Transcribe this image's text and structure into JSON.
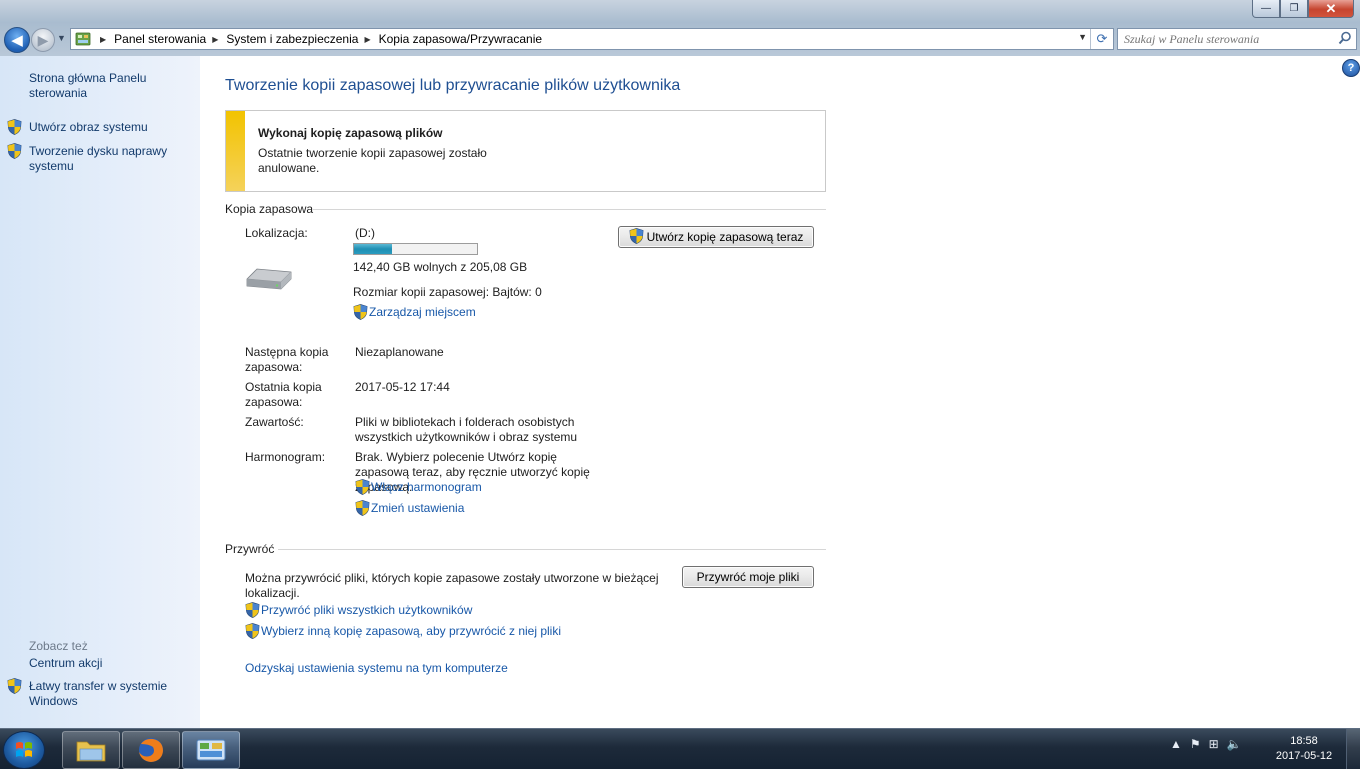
{
  "window": {
    "minimize": "—",
    "maximize": "❐",
    "close": "✕"
  },
  "address": {
    "crumbs": [
      "Panel sterowania",
      "System i zabezpieczenia",
      "Kopia zapasowa/Przywracanie"
    ]
  },
  "search": {
    "placeholder": "Szukaj w Panelu sterowania"
  },
  "sidebar": {
    "home": "Strona główna Panelu sterowania",
    "items": [
      "Utwórz obraz systemu",
      "Tworzenie dysku naprawy systemu"
    ],
    "see_also_title": "Zobacz też",
    "see_also": [
      "Centrum akcji",
      "Łatwy transfer w systemie Windows"
    ]
  },
  "main": {
    "title": "Tworzenie kopii zapasowej lub przywracanie plików użytkownika",
    "alert": {
      "title": "Wykonaj kopię zapasową plików",
      "text": "Ostatnie tworzenie kopii zapasowej zostało anulowane."
    },
    "backup": {
      "heading": "Kopia zapasowa",
      "location_label": "Lokalizacja:",
      "drive": "(D:)",
      "disk_used_fraction": 0.31,
      "free_space": "142,40 GB wolnych z 205,08 GB",
      "backup_size": "Rozmiar kopii zapasowej: Bajtów: 0",
      "manage_space": "Zarządzaj miejscem",
      "backup_now_button": "Utwórz kopię zapasową teraz",
      "next_label": "Następna kopia zapasowa:",
      "next_value": "Niezaplanowane",
      "last_label": "Ostatnia kopia zapasowa:",
      "last_value": "2017-05-12 17:44",
      "contents_label": "Zawartość:",
      "contents_value": "Pliki w bibliotekach i folderach osobistych wszystkich użytkowników i obraz systemu",
      "schedule_label": "Harmonogram:",
      "schedule_value": "Brak. Wybierz polecenie Utwórz kopię zapasową teraz, aby ręcznie utworzyć kopię zapasową.",
      "turn_on_schedule": "Włącz harmonogram",
      "change_settings": "Zmień ustawienia"
    },
    "restore": {
      "heading": "Przywróć",
      "text": "Można przywrócić pliki, których kopie zapasowe zostały utworzone w bieżącej lokalizacji.",
      "restore_button": "Przywróć moje pliki",
      "restore_all": "Przywróć pliki wszystkich użytkowników",
      "select_other": "Wybierz inną kopię zapasową, aby przywrócić z niej pliki",
      "recover_settings": "Odzyskaj ustawienia systemu na tym komputerze"
    }
  },
  "taskbar": {
    "time": "18:58",
    "date": "2017-05-12"
  },
  "icons": {
    "shield": "uac-shield-icon",
    "drive": "hard-drive-icon",
    "help": "help-icon"
  },
  "colors": {
    "link": "#1858a8",
    "title": "#1f4f92",
    "alert_bar": "#f2c300",
    "progress": "#1f8fb3"
  }
}
